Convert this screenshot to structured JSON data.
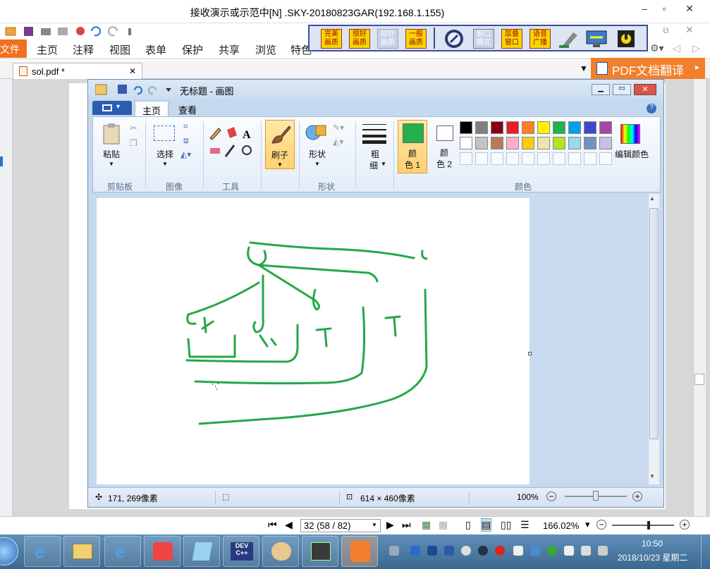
{
  "window": {
    "title": "接收演示或示范中[N] .SKY-20180823GAR(192.168.1.155)",
    "minimize": "–",
    "restore": "▫",
    "close": "✕"
  },
  "remote_toolbar": {
    "buttons": [
      "完美\n画质",
      "很好\n画质",
      "较好\n画质",
      "一般\n画质",
      "窗口\n模式",
      "层叠\n窗口",
      "语音\n广播"
    ]
  },
  "pdf_app": {
    "file_tab": "文件",
    "tabs": [
      "主页",
      "注释",
      "视图",
      "表单",
      "保护",
      "共享",
      "浏览",
      "特色功能"
    ],
    "doc_tab": "sol.pdf *",
    "doc_tab_close": "✕",
    "translate_label": "PDF文档翻译",
    "nav": {
      "page_value": "32 (58 / 82)",
      "zoom": "166.02%"
    }
  },
  "paint": {
    "title": "无标题 - 画图",
    "tabs": [
      "主页",
      "查看"
    ],
    "groups": {
      "clipboard": "剪贴板",
      "image": "图像",
      "tools": "工具",
      "shapes": "形状",
      "colors": "颜色"
    },
    "buttons": {
      "paste": "粘贴",
      "select": "选择",
      "brush": "刷子",
      "shape": "形状",
      "size_top": "粗",
      "size_bottom": "细",
      "color1_top": "颜",
      "color1_bottom": "色 1",
      "color2_top": "颜",
      "color2_bottom": "色 2",
      "edit_colors": "编辑颜色"
    },
    "colors": {
      "color1": "#22b14c",
      "color2": "#ffffff",
      "palette_row1": [
        "#000000",
        "#7f7f7f",
        "#880015",
        "#ed1c24",
        "#ff7f27",
        "#fff200",
        "#22b14c",
        "#00a2e8",
        "#3f48cc",
        "#a349a4"
      ],
      "palette_row2": [
        "#ffffff",
        "#c3c3c3",
        "#b97a57",
        "#ffaec9",
        "#ffc90e",
        "#efe4b0",
        "#b5e61d",
        "#99d9ea",
        "#7092be",
        "#c8bfe7"
      ],
      "stroke": "#22a84a"
    },
    "status": {
      "cursor_pos": "171, 269像素",
      "image_size": "614 × 460像素",
      "zoom": "100%"
    }
  },
  "taskbar": {
    "time": "10:50",
    "date": "2018/10/23 星期二",
    "apps": [
      "ie-icon",
      "explorer-icon",
      "ie-alt-icon",
      "paint-app-icon",
      "notes-icon",
      "devcpp-icon",
      "paint-palette-icon",
      "editor-icon",
      "pdf-reader-icon"
    ]
  }
}
